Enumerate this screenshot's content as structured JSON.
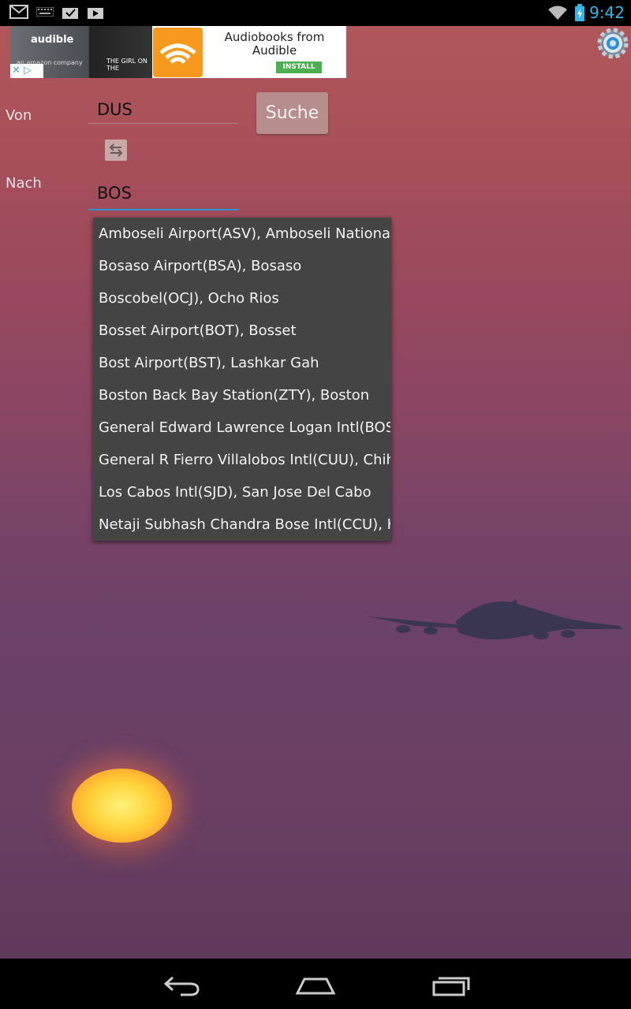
{
  "status_bar": {
    "time": "9:42",
    "icons": [
      "gmail-icon",
      "keyboard-icon",
      "task-icon",
      "store-icon",
      "wifi-icon",
      "battery-icon"
    ]
  },
  "ad": {
    "brand": "audible",
    "brand_sub": "an amazon company",
    "book_text": "THE GIRL ON THE",
    "title": "Audiobooks from Audible",
    "install_label": "INSTALL",
    "close_glyph": "✕ ▷"
  },
  "form": {
    "from_label": "Von",
    "from_value": "DUS",
    "to_label": "Nach",
    "to_value": "BOS",
    "search_label": "Suche"
  },
  "suggestions": [
    "Amboseli Airport(ASV), Amboseli National",
    "Bosaso Airport(BSA), Bosaso",
    "Boscobel(OCJ), Ocho Rios",
    "Bosset Airport(BOT), Bosset",
    "Bost Airport(BST), Lashkar Gah",
    "Boston Back Bay Station(ZTY), Boston",
    "General Edward Lawrence Logan Intl(BOS),",
    "General R Fierro Villalobos Intl(CUU), Chihu",
    "Los Cabos Intl(SJD), San Jose Del Cabo",
    "Netaji Subhash Chandra Bose Intl(CCU), Ko"
  ],
  "colors": {
    "accent": "#33b5e5",
    "dropdown_bg": "#444444",
    "search_button": "#b68e8e"
  }
}
